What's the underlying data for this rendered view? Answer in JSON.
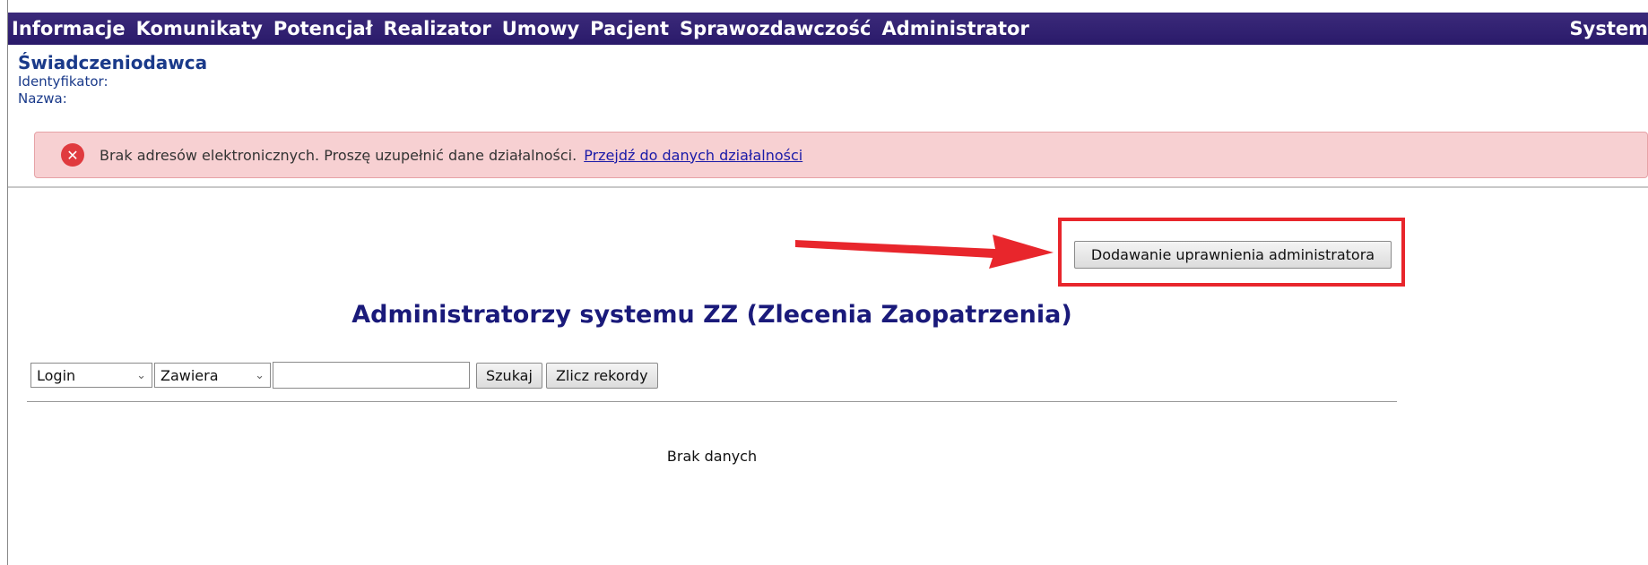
{
  "menu": {
    "items": [
      "Informacje",
      "Komunikaty",
      "Potencjał",
      "Realizator",
      "Umowy",
      "Pacjent",
      "Sprawozdawczość",
      "Administrator"
    ],
    "right_item": "System"
  },
  "provider": {
    "title": "Świadczeniodawca",
    "id_label": "Identyfikator:",
    "name_label": "Nazwa:"
  },
  "alert": {
    "icon": "error-x-icon",
    "message": "Brak adresów elektronicznych. Proszę uzupełnić dane działalności.",
    "link": "Przejdź do danych działalności",
    "color": "#f7d0d2"
  },
  "annotation": {
    "arrow_color": "#e8262c",
    "highlight_color": "#e8262c"
  },
  "actions": {
    "add_admin_label": "Dodawanie uprawnienia administratora"
  },
  "page": {
    "heading": "Administratorzy systemu ZZ (Zlecenia Zaopatrzenia)"
  },
  "search": {
    "field_selected": "Login",
    "operator_selected": "Zawiera",
    "value": "",
    "search_label": "Szukaj",
    "count_label": "Zlicz rekordy"
  },
  "results": {
    "empty_text": "Brak danych"
  },
  "colors": {
    "menu_bg": "#2e1e6e",
    "heading": "#1a1a7a"
  }
}
